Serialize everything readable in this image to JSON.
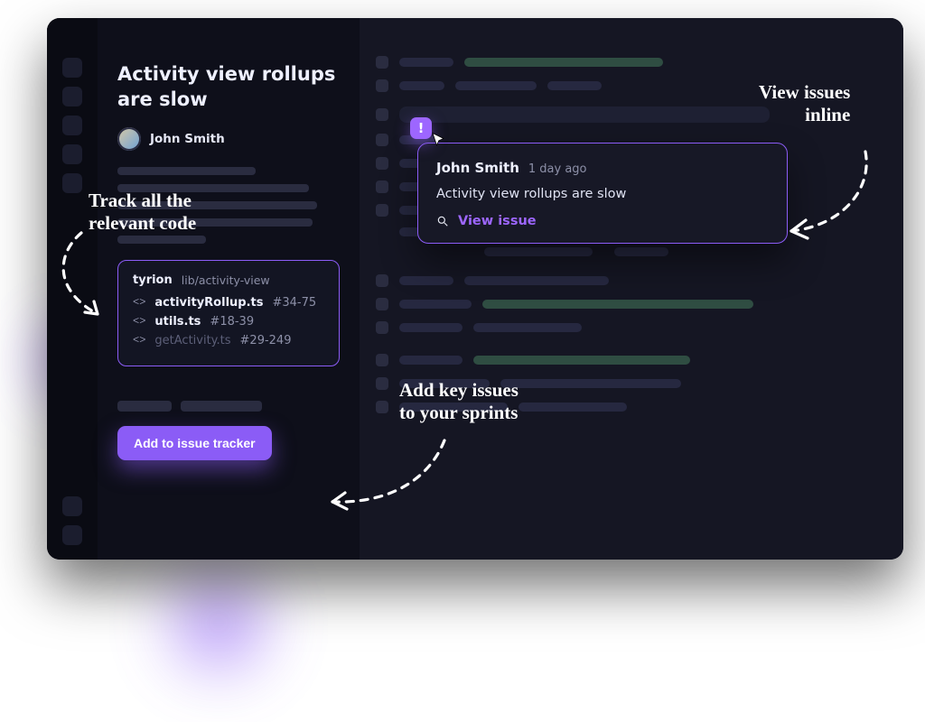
{
  "issue": {
    "title": "Activity view rollups are slow",
    "author": "John Smith"
  },
  "code_card": {
    "project": "tyrion",
    "path": "lib/activity-view",
    "files": [
      {
        "name": "activityRollup.ts",
        "range": "#34-75",
        "active": true
      },
      {
        "name": "utils.ts",
        "range": "#18-39",
        "active": true
      },
      {
        "name": "getActivity.ts",
        "range": "#29-249",
        "active": false
      }
    ]
  },
  "sidebar": {
    "add_button": "Add to issue tracker"
  },
  "popover": {
    "author": "John Smith",
    "age": "1 day ago",
    "title": "Activity view rollups are slow",
    "view_label": "View issue"
  },
  "annotations": {
    "track_code": "Track all the\nrelevant code",
    "add_sprints": "Add key issues\nto your sprints",
    "view_inline": "View issues\ninline"
  },
  "colors": {
    "accent": "#8b5cf6",
    "background": "#0c0d16"
  }
}
